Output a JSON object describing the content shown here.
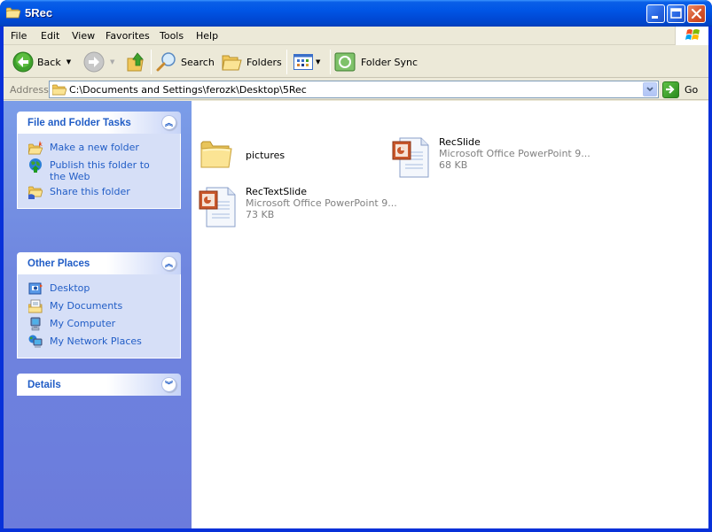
{
  "window": {
    "title": "5Rec",
    "controls": {
      "minimize": "minimize",
      "maximize": "maximize",
      "close": "close"
    }
  },
  "menubar": {
    "items": [
      "File",
      "Edit",
      "View",
      "Favorites",
      "Tools",
      "Help"
    ]
  },
  "toolbar": {
    "back_label": "Back",
    "forward_label": "",
    "up_label": "",
    "search_label": "Search",
    "folders_label": "Folders",
    "views_label": "",
    "folder_sync_label": "Folder Sync"
  },
  "address": {
    "label": "Address",
    "value": "C:\\Documents and Settings\\ferozk\\Desktop\\5Rec",
    "go_label": "Go"
  },
  "taskpane": {
    "file_tasks": {
      "title": "File and Folder Tasks",
      "items": [
        {
          "label": "Make a new folder",
          "icon": "new-folder-icon"
        },
        {
          "label": "Publish this folder to the Web",
          "icon": "publish-web-icon"
        },
        {
          "label": "Share this folder",
          "icon": "share-folder-icon"
        }
      ]
    },
    "other_places": {
      "title": "Other Places",
      "items": [
        {
          "label": "Desktop",
          "icon": "desktop-icon"
        },
        {
          "label": "My Documents",
          "icon": "my-documents-icon"
        },
        {
          "label": "My Computer",
          "icon": "my-computer-icon"
        },
        {
          "label": "My Network Places",
          "icon": "network-places-icon"
        }
      ]
    },
    "details": {
      "title": "Details"
    }
  },
  "files": [
    {
      "name": "pictures",
      "type": "folder"
    },
    {
      "name": "RecSlide",
      "type": "Microsoft Office PowerPoint 9...",
      "size": "68 KB"
    },
    {
      "name": "RecTextSlide",
      "type": "Microsoft Office PowerPoint 9...",
      "size": "73 KB"
    }
  ],
  "colors": {
    "titlebar_blue": "#0055e5",
    "taskpane_blue": "#6f86df",
    "link_blue": "#215dc6",
    "close_red": "#d4512a"
  }
}
